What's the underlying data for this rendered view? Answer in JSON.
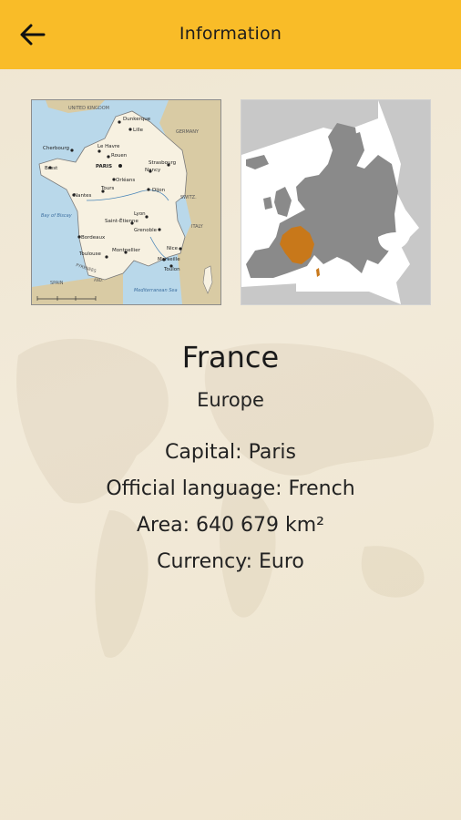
{
  "header": {
    "title": "Information",
    "back_icon": "arrow-left-icon",
    "background_color": "#f9bc28"
  },
  "maps": {
    "france_map": {
      "labels": {
        "uk": "UNITED KINGDOM",
        "dunkerque": "Dunkerque",
        "lille": "Lille",
        "germany": "GERMANY",
        "cherbourg": "Cherbourg",
        "le_havre": "Le Havre",
        "rouen": "Rouen",
        "brest": "Brest",
        "paris": "PARIS",
        "strasbourg": "Strasbourg",
        "nancy": "Nancy",
        "orleans": "Orléans",
        "nantes": "Nantes",
        "tours": "Tours",
        "dijon": "Dijon",
        "switzerland": "SWITZ.",
        "bay_of_biscay": "Bay of Biscay",
        "lyon": "Lyon",
        "saint_etienne": "Saint-Étienne",
        "grenoble": "Grenoble",
        "italy": "ITALY",
        "bordeaux": "Bordeaux",
        "toulouse": "Toulouse",
        "montpellier": "Montpellier",
        "nice": "Nice",
        "marseille": "Marseille",
        "toulon": "Toulon",
        "pyrenees": "PYRENEES",
        "spain": "SPAIN",
        "andorra": "AND.",
        "mediterranean": "Mediterranean Sea"
      },
      "colors": {
        "sea": "#b9d8ea",
        "france": "#f7f1e1",
        "neighbors": "#d9cba4"
      }
    },
    "europe_map": {
      "colors": {
        "highlight": "#c8781a",
        "land": "#8a8a8a",
        "other": "#c8c8c8"
      }
    }
  },
  "country": {
    "name": "France",
    "continent": "Europe",
    "facts": [
      {
        "label": "Capital: ",
        "value": "Paris"
      },
      {
        "label": "Official language: ",
        "value": "French"
      },
      {
        "label": "Area: ",
        "value": "640 679 km²"
      },
      {
        "label": "Currency: ",
        "value": "Euro"
      }
    ]
  }
}
